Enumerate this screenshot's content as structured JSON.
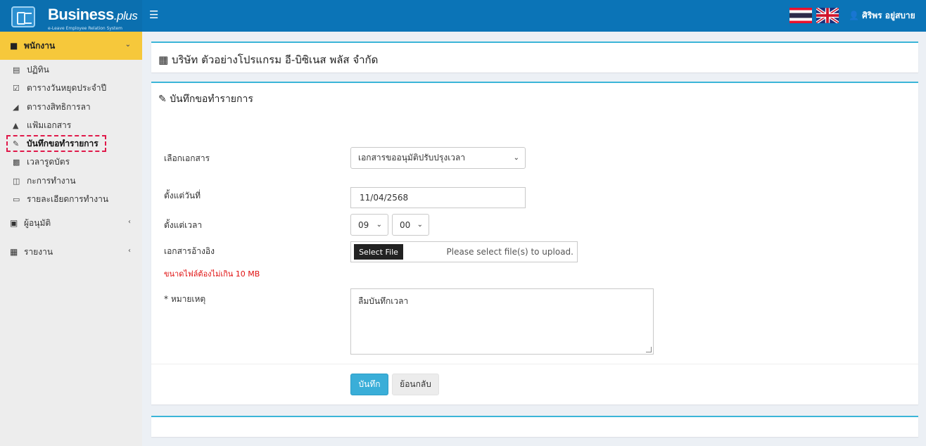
{
  "brand": {
    "name": "Business",
    "name_suffix": ".plus",
    "tagline": "e-Leave Employee Relation System"
  },
  "topbar": {
    "menu_icon": "hamburger-icon",
    "user_name": "ศิริพร อยู่สบาย"
  },
  "sidebar": {
    "sections": [
      {
        "label": "พนักงาน",
        "icon": "user-icon"
      },
      {
        "label": "ผู้อนุมัติ",
        "icon": "approver-icon"
      },
      {
        "label": "รายงาน",
        "icon": "report-icon"
      }
    ],
    "items": [
      {
        "label": "ปฏิทิน",
        "icon": "calendar-icon"
      },
      {
        "label": "ตารางวันหยุดประจำปี",
        "icon": "calendar-check-icon"
      },
      {
        "label": "ตารางสิทธิการลา",
        "icon": "area-chart-icon"
      },
      {
        "label": "แฟ้มเอกสาร",
        "icon": "folder-icon"
      },
      {
        "label": "บันทึกขอทำรายการ",
        "icon": "pencil-icon"
      },
      {
        "label": "เวลารูดบัตร",
        "icon": "card-icon"
      },
      {
        "label": "กะการทำงาน",
        "icon": "columns-icon"
      },
      {
        "label": "รายละเอียดการทำงาน",
        "icon": "monitor-icon"
      }
    ]
  },
  "company": {
    "title": "บริษัท ตัวอย่างโปรแกรม อี-บิซิเนส พลัส จำกัด"
  },
  "form": {
    "title": "บันทึกขอทำรายการ",
    "document_label": "เลือกเอกสาร",
    "document_value": "เอกสารขออนุมัติปรับปรุงเวลา",
    "date_label": "ตั้งแต่วันที่",
    "date_value": "11/04/2568",
    "time_label": "ตั้งแต่เวลา",
    "hour_value": "09",
    "minute_value": "00",
    "attachment_label": "เอกสารอ้างอิง",
    "file_button": "Select File",
    "file_hint": "Please select file(s) to upload.",
    "size_warning": "ขนาดไฟล์ต้องไม่เกิน 10 MB",
    "remark_label": "* หมายเหตุ",
    "remark_value": "ลืมบันทึกเวลา",
    "save_label": "บันทึก",
    "back_label": "ย้อนกลับ"
  },
  "colors": {
    "topbar": "#0b74b7",
    "active_menu": "#f6c83b",
    "panel_border": "#3bb5d8",
    "save_button": "#3aaed8",
    "warning": "#e01010",
    "highlight": "#e0194a"
  }
}
